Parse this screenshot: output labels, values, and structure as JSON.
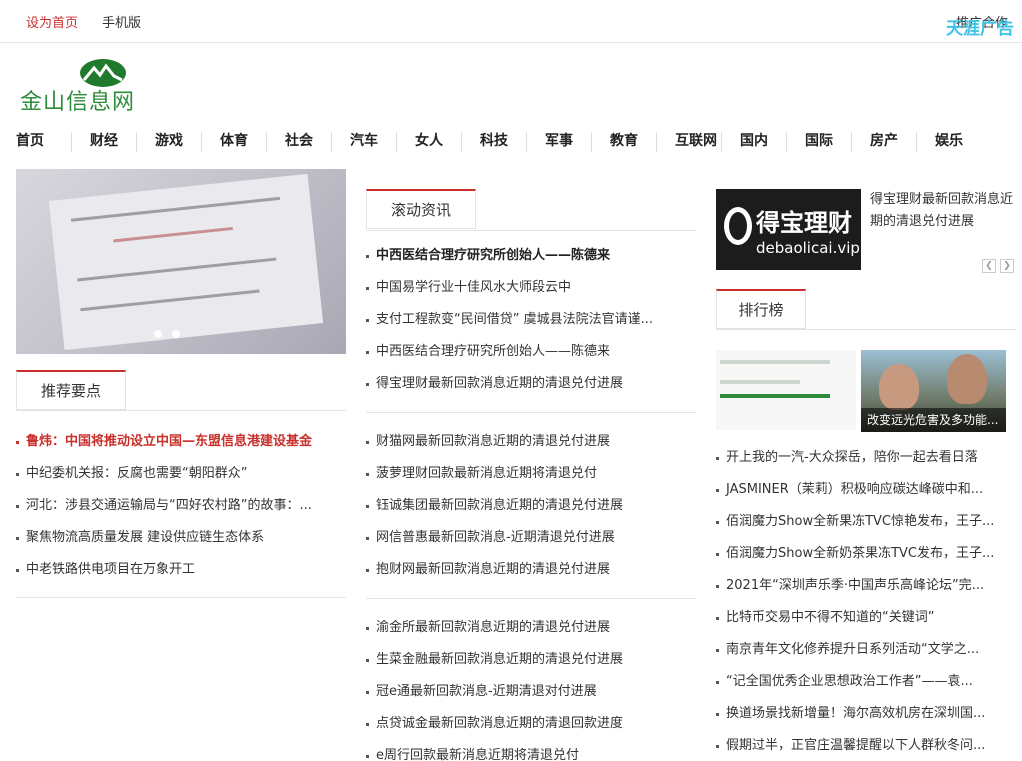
{
  "topbar": {
    "set_home": "设为首页",
    "mobile": "手机版",
    "right_text": "推广合作",
    "ad_badge": "天涯广告"
  },
  "logo": {
    "text": "金山信息网"
  },
  "nav": [
    "首页",
    "财经",
    "游戏",
    "体育",
    "社会",
    "汽车",
    "女人",
    "科技",
    "军事",
    "教育",
    "互联网",
    "国内",
    "国际",
    "房产",
    "娱乐"
  ],
  "recommend": {
    "tab": "推荐要点",
    "items": [
      "鲁炜：中国将推动设立中国—东盟信息港建设基金",
      "中纪委机关报：反腐也需要“朝阳群众”",
      "河北：涉县交通运输局与“四好农村路”的故事：...",
      "聚焦物流高质量发展 建设供应链生态体系",
      "中老铁路供电项目在万象开工"
    ]
  },
  "scrolling": {
    "tab": "滚动资讯",
    "group1": [
      "中西医结合理疗研究所创始人——陈德来",
      "中国易学行业十佳风水大师段云中",
      "支付工程款变“民间借贷” 虞城县法院法官请谨...",
      "中西医结合理疗研究所创始人——陈德来",
      "得宝理财最新回款消息近期的清退兑付进展"
    ],
    "group2": [
      "财猫网最新回款消息近期的清退兑付进展",
      "菠萝理财回款最新消息近期将清退兑付",
      "钰诚集团最新回款消息近期的清退兑付进展",
      "网信普惠最新回款消息-近期清退兑付进展",
      "抱财网最新回款消息近期的清退兑付进展"
    ],
    "group3": [
      "渝金所最新回款消息近期的清退兑付进展",
      "生菜金融最新回款消息近期的清退兑付进展",
      "冠e通最新回款消息-近期清退对付进展",
      "点贷诚金最新回款消息近期的清退回款进度",
      "e周行回款最新消息近期将清退兑付"
    ]
  },
  "ad": {
    "brand_cn": "得宝理财",
    "brand_en": "debaolicai.vip",
    "title": "得宝理财最新回款消息近期的清退兑付进展"
  },
  "ranking": {
    "tab": "排行榜",
    "thumb_caption": "改变远光危害及多功能...",
    "items": [
      "开上我的一汽-大众探岳，陪你一起去看日落",
      "JASMINER（茉莉）积极响应碳达峰碳中和...",
      "佰润魔力Show全新果冻TVC惊艳发布，王子...",
      "佰润魔力Show全新奶茶果冻TVC发布，王子...",
      "2021年“深圳声乐季·中国声乐高峰论坛”完...",
      "比特币交易中不得不知道的“关键词”",
      "南京青年文化修养提升日系列活动“文学之...",
      "“记全国优秀企业思想政治工作者”——袁...",
      "换道场景找新增量！海尔高效机房在深圳国...",
      "假期过半，正官庄温馨提醒以下人群秋冬问..."
    ]
  }
}
